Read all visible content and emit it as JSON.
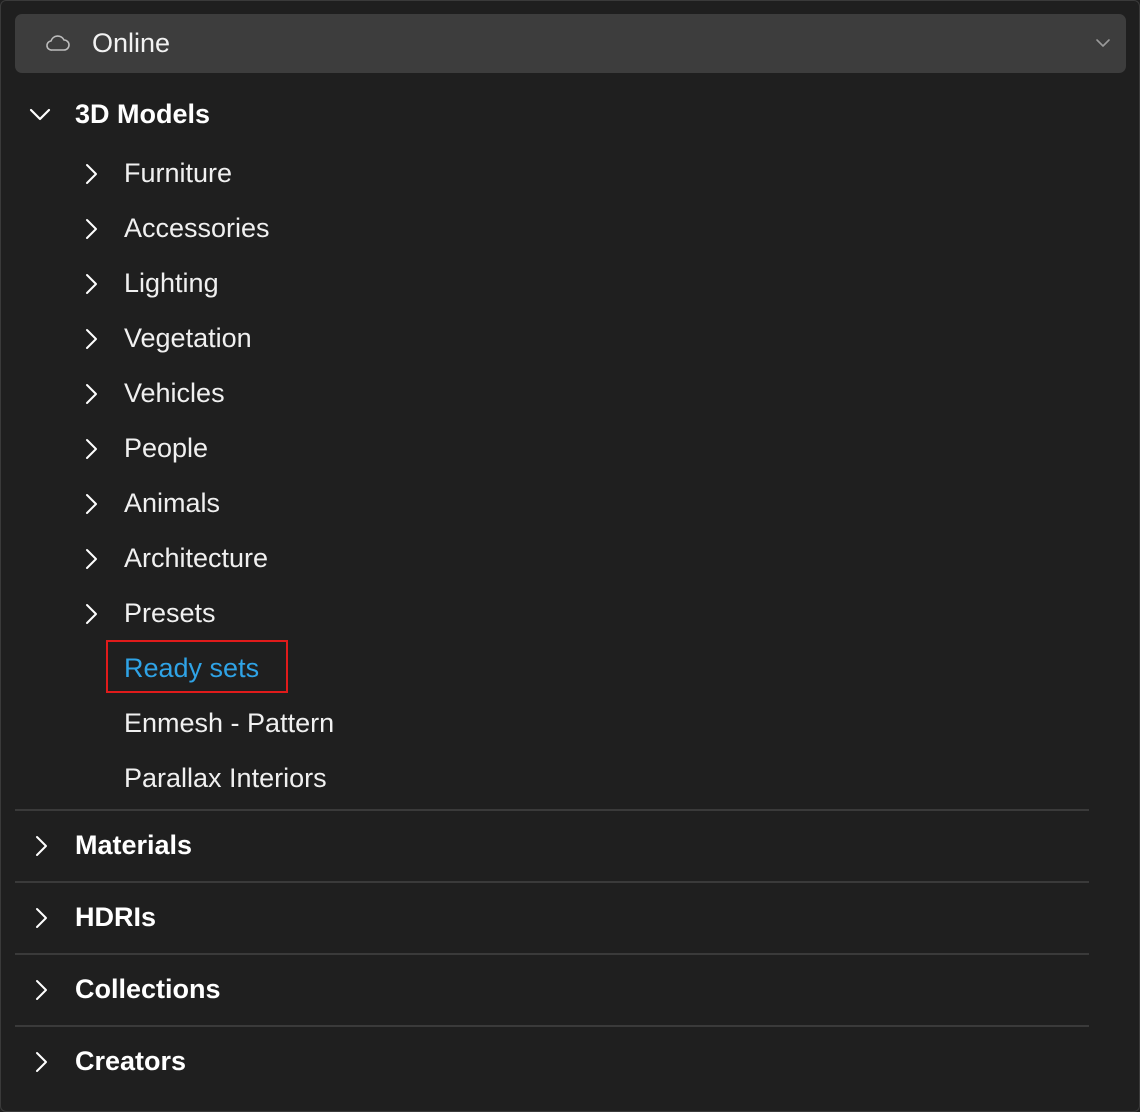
{
  "source": {
    "label": "Online",
    "icon": "cloud-icon",
    "dropdown_icon": "chevron-down-icon"
  },
  "tree": {
    "models": {
      "label": "3D Models",
      "children": [
        "Furniture",
        "Accessories",
        "Lighting",
        "Vegetation",
        "Vehicles",
        "People",
        "Animals",
        "Architecture",
        "Presets"
      ],
      "leaves": [
        "Ready sets",
        "Enmesh - Pattern",
        "Parallax Interiors"
      ],
      "selected": "Ready sets"
    },
    "sections": [
      "Materials",
      "HDRIs",
      "Collections",
      "Creators"
    ]
  },
  "colors": {
    "background": "#1f1f1f",
    "dropdown_bg": "#3d3d3d",
    "selected_text": "#2fa3e6",
    "highlight_box": "#e01b1b"
  }
}
